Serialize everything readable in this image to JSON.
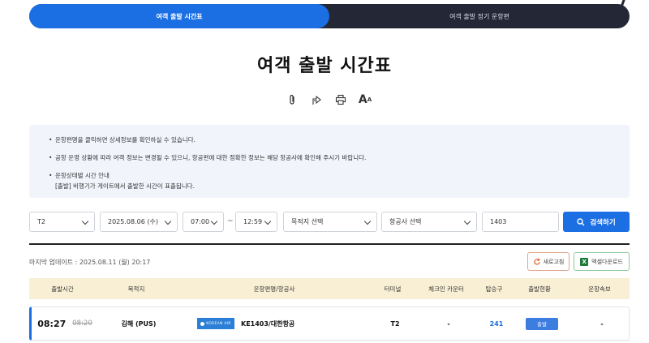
{
  "tabs": [
    {
      "label": "여객 출발 시간표",
      "active": true
    },
    {
      "label": "여객 출발 정기 운항편",
      "active": false
    }
  ],
  "page": {
    "title": "여객 출발 시간표"
  },
  "utilities": [
    {
      "icon": "paperclip-icon"
    },
    {
      "icon": "share-icon"
    },
    {
      "icon": "print-icon"
    },
    {
      "icon": "font-size-icon",
      "label": "A",
      "sub": "A"
    }
  ],
  "notice": {
    "items": [
      "운항편명을 클릭하면 상세정보를 확인하실 수 있습니다.",
      "공항 운영 상황에 따라 여객 정보는 변경될 수 있으니, 항공편에 대한 정확한 정보는 해당 항공사에 확인해 주시기 바랍니다."
    ],
    "status_title": "운항상태별 시간 안내",
    "status_detail": "[출발] 비행기가 게이트에서 출발한 시간이 표출됩니다."
  },
  "filters": {
    "terminal": "T2",
    "date": "2025.08.06 (수)",
    "time_from": "07:00",
    "tilde": "~",
    "time_to": "12:59",
    "destination_placeholder": "목적지 선택",
    "airline_placeholder": "항공사 선택",
    "keyword": "1403",
    "search_label": "검색하기"
  },
  "meta": {
    "updated": "마지막 업데이트 : 2025.08.11 (월) 20:17",
    "refresh_label": "새로고침",
    "excel_label": "엑셀다운로드",
    "excel_mark": "X"
  },
  "table": {
    "headers": [
      "출발시간",
      "목적지",
      "운항편명/항공사",
      "터미널",
      "체크인 카운터",
      "탑승구",
      "출발현황",
      "운항속보"
    ],
    "rows": [
      {
        "time_actual": "08:27",
        "time_scheduled": "08:20",
        "destination": "김해 (PUS)",
        "airline_logo_text": "KOREAN AIR",
        "flight": "KE1403/대한항공",
        "terminal": "T2",
        "checkin": "-",
        "gate": "241",
        "status": "출발",
        "news": "-"
      }
    ]
  },
  "colors": {
    "accent": "#1b6fe3",
    "tabbar": "#232736",
    "notice_bg": "#f1f5fb",
    "header_bg": "#f8efd4"
  }
}
